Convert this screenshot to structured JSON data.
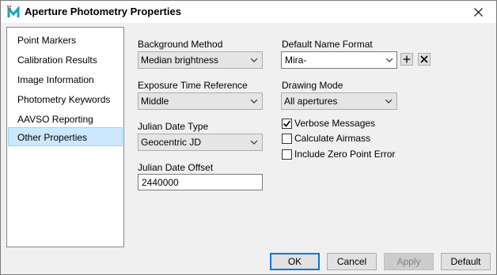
{
  "window": {
    "title": "Aperture Photometry Properties"
  },
  "nav": {
    "items": [
      {
        "label": "Point Markers"
      },
      {
        "label": "Calibration Results"
      },
      {
        "label": "Image Information"
      },
      {
        "label": "Photometry Keywords"
      },
      {
        "label": "AAVSO Reporting"
      },
      {
        "label": "Other Properties"
      }
    ],
    "selected": "Other Properties"
  },
  "form": {
    "background_method": {
      "label": "Background Method",
      "value": "Median brightness"
    },
    "exposure_time_reference": {
      "label": "Exposure Time Reference",
      "value": "Middle"
    },
    "julian_date_type": {
      "label": "Julian Date Type",
      "value": "Geocentric JD"
    },
    "julian_date_offset": {
      "label": "Julian Date Offset",
      "value": "2440000"
    },
    "default_name_format": {
      "label": "Default Name Format",
      "value": "Mira-"
    },
    "drawing_mode": {
      "label": "Drawing Mode",
      "value": "All apertures"
    },
    "checkboxes": [
      {
        "label": "Verbose Messages",
        "checked": true
      },
      {
        "label": "Calculate Airmass",
        "checked": false
      },
      {
        "label": "Include Zero Point Error",
        "checked": false
      }
    ]
  },
  "buttons": {
    "ok": "OK",
    "cancel": "Cancel",
    "apply": "Apply",
    "default": "Default"
  },
  "colors": {
    "selection_bg": "#cce8ff",
    "focus_border": "#0078d7",
    "delete_icon": "#000000"
  },
  "icons": {
    "app": "aperture-photometry-app-icon",
    "close": "close-icon",
    "add": "plus-icon",
    "remove": "x-icon",
    "dropdown": "chevron-down-icon"
  }
}
